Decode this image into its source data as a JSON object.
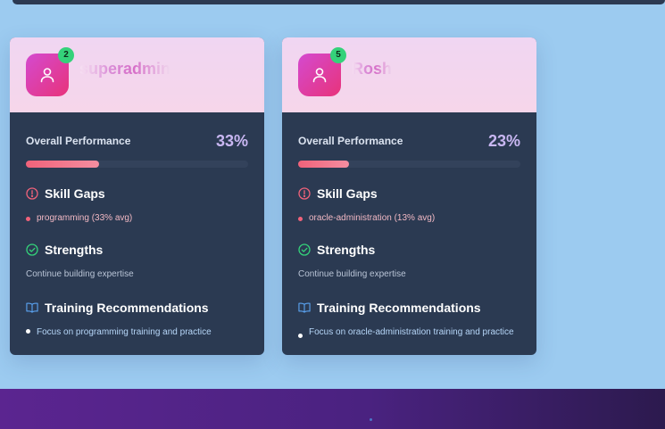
{
  "colors": {
    "background": "#9ccbf0",
    "card_body": "#2b3a52",
    "accent_pink": "#f0627a",
    "success_green": "#34d27a",
    "footer_purple": "#5b2590"
  },
  "labels": {
    "overall_performance": "Overall Performance",
    "skill_gaps": "Skill Gaps",
    "strengths": "Strengths",
    "training_recommendations": "Training Recommendations"
  },
  "icons": {
    "avatar": "user-icon",
    "skill_gaps": "alert-circle-icon",
    "strengths": "check-circle-icon",
    "training": "book-open-icon"
  },
  "cards": [
    {
      "name": "superadmin",
      "badge": "2",
      "performance_text": "33%",
      "performance": 0.33,
      "skill_gaps": [
        "programming (33% avg)"
      ],
      "strengths_text": "Continue building expertise",
      "training": [
        "Focus on programming training and practice"
      ]
    },
    {
      "name": "Rosh",
      "badge": "5",
      "performance_text": "23%",
      "performance": 0.23,
      "skill_gaps": [
        "oracle-administration (13% avg)"
      ],
      "strengths_text": "Continue building expertise",
      "training": [
        "Focus on oracle-administration training and practice"
      ]
    }
  ]
}
